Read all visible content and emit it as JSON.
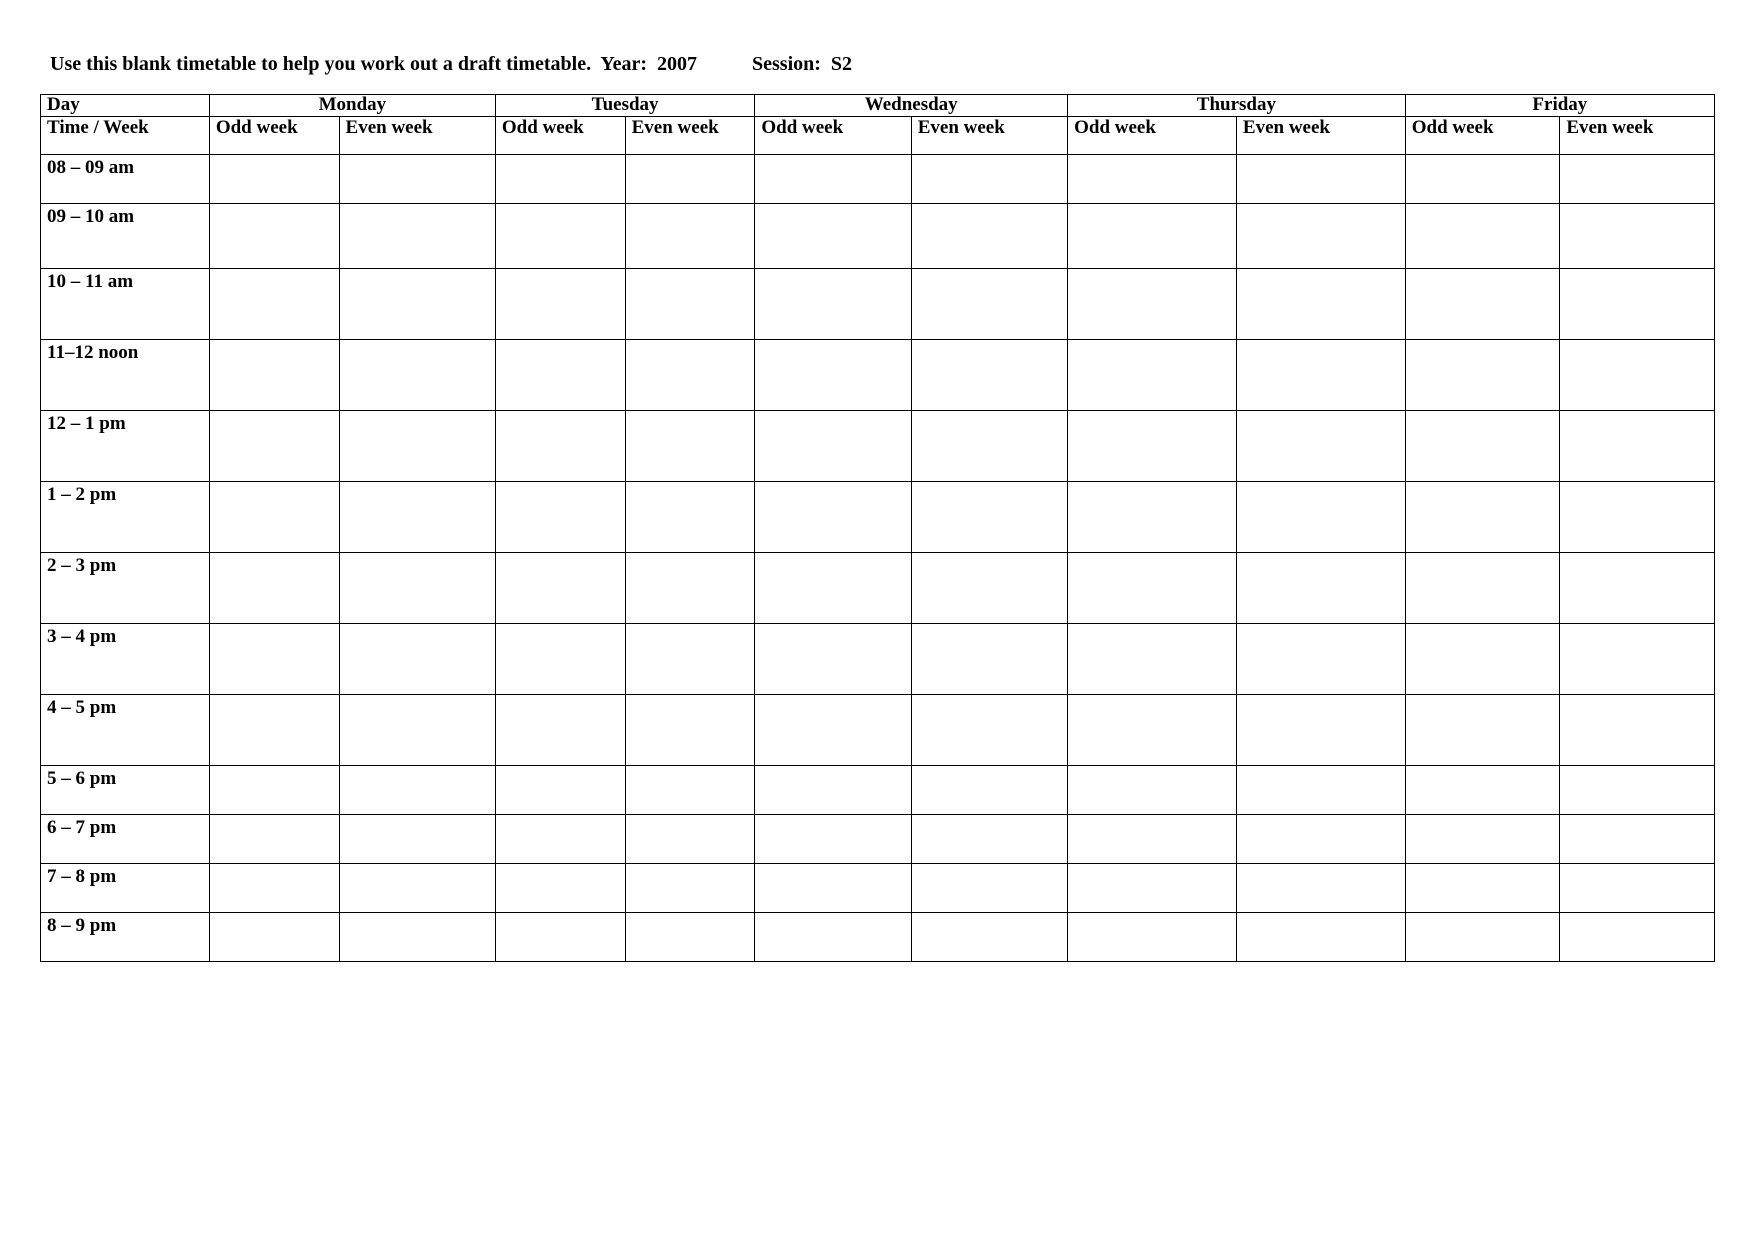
{
  "heading_prefix": "Use this blank timetable to help you work out a draft timetable.  Year:  ",
  "year": "2007",
  "heading_session_label": "           Session:  ",
  "session": "S2",
  "table": {
    "day_label": "Day",
    "time_week_label": "Time / Week",
    "days": [
      "Monday",
      "Tuesday",
      "Wednesday",
      "Thursday",
      "Friday"
    ],
    "sub_columns": [
      "Odd week",
      "Even week"
    ],
    "rows": [
      {
        "label": "08 – 09 am",
        "height": "short"
      },
      {
        "label": "09 – 10 am",
        "height": "med"
      },
      {
        "label": "10 – 11 am",
        "height": "tall"
      },
      {
        "label": "11–12 noon",
        "height": "tall"
      },
      {
        "label": "12 – 1 pm",
        "height": "tall"
      },
      {
        "label": "1 – 2  pm",
        "height": "tall"
      },
      {
        "label": "2 – 3  pm",
        "height": "tall"
      },
      {
        "label": "3 – 4  pm",
        "height": "tall"
      },
      {
        "label": "4 – 5  pm",
        "height": "tall"
      },
      {
        "label": "5 – 6  pm",
        "height": "short"
      },
      {
        "label": "6 – 7  pm",
        "height": "short"
      },
      {
        "label": "7 – 8  pm",
        "height": "short"
      },
      {
        "label": "8 – 9  pm",
        "height": "short"
      }
    ]
  }
}
